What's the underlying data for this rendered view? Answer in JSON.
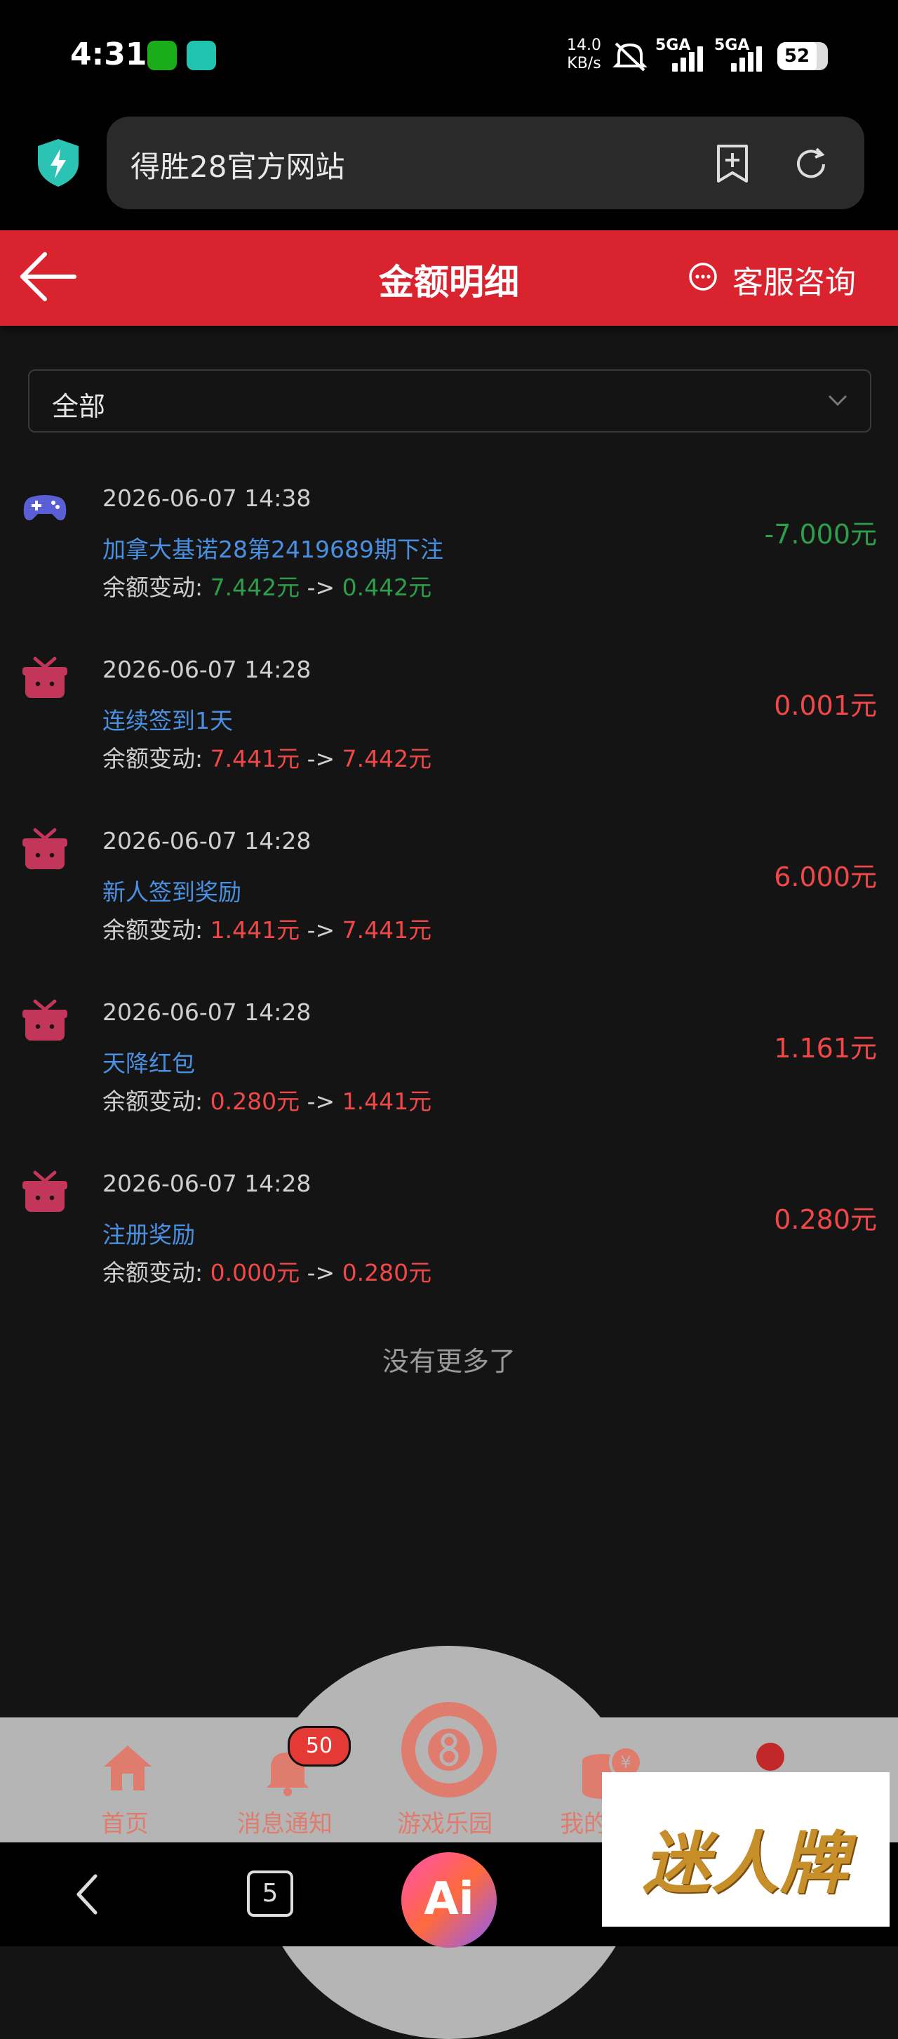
{
  "status_bar": {
    "time": "4:31",
    "net_speed": "14.0",
    "net_unit": "KB/s",
    "sim1": "5GA",
    "sim2": "5GA",
    "battery": "52"
  },
  "browser": {
    "url_text": "得胜28官方网站"
  },
  "header": {
    "title": "金额明细",
    "service_label": "客服咨询"
  },
  "filter": {
    "selected": "全部"
  },
  "records": [
    {
      "icon": "gamepad-icon",
      "date": "2026-06-07 14:38",
      "desc": "加拿大基诺28第2419689期下注",
      "bal_label": "余额变动: ",
      "bal_from": "7.442元",
      "arrow": " -> ",
      "bal_to": "0.442元",
      "amount": "-7.000元",
      "sign": "neg"
    },
    {
      "icon": "gift-icon",
      "date": "2026-06-07 14:28",
      "desc": "连续签到1天",
      "bal_label": "余额变动: ",
      "bal_from": "7.441元",
      "arrow": " -> ",
      "bal_to": "7.442元",
      "amount": "0.001元",
      "sign": "pos"
    },
    {
      "icon": "gift-icon",
      "date": "2026-06-07 14:28",
      "desc": "新人签到奖励",
      "bal_label": "余额变动: ",
      "bal_from": "1.441元",
      "arrow": " -> ",
      "bal_to": "7.441元",
      "amount": "6.000元",
      "sign": "pos"
    },
    {
      "icon": "gift-icon",
      "date": "2026-06-07 14:28",
      "desc": "天降红包",
      "bal_label": "余额变动: ",
      "bal_from": "0.280元",
      "arrow": " -> ",
      "bal_to": "1.441元",
      "amount": "1.161元",
      "sign": "pos"
    },
    {
      "icon": "gift-icon",
      "date": "2026-06-07 14:28",
      "desc": "注册奖励",
      "bal_label": "余额变动: ",
      "bal_from": "0.000元",
      "arrow": " -> ",
      "bal_to": "0.280元",
      "amount": "0.280元",
      "sign": "pos"
    }
  ],
  "footer_note": "没有更多了",
  "tabbar": {
    "home": "首页",
    "messages": "消息通知",
    "messages_badge": "50",
    "games": "游戏乐园",
    "mine": "我的"
  },
  "system_nav": {
    "tabs_count": "5",
    "ai_label": "Ai"
  },
  "watermark": "迷人牌",
  "colors": {
    "header_red": "#d9242f",
    "desc_blue": "#4a90e2",
    "negative_green": "#2e9e4a",
    "positive_red": "#f04848"
  }
}
